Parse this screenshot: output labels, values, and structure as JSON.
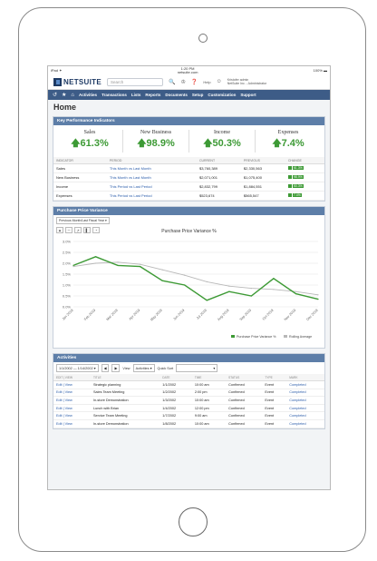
{
  "statusbar": {
    "left": "iPad ✦",
    "time": "1:20 PM",
    "url": "netsuite.com",
    "right": "100% ▬"
  },
  "topbar": {
    "logo_text": "NETSUITE",
    "search_placeholder": "Search",
    "help": "Help",
    "user_name": "Kristofer admin",
    "user_role": "NetSuite Inc. - Administrator"
  },
  "nav": {
    "items": [
      "Activities",
      "Transactions",
      "Lists",
      "Reports",
      "Documents",
      "Setup",
      "Customization",
      "Support"
    ]
  },
  "page_title": "Home",
  "kpi_panel": {
    "title": "Key Performance Indicators",
    "kpis": [
      {
        "label": "Sales",
        "value": "61.3%"
      },
      {
        "label": "New Business",
        "value": "98.9%"
      },
      {
        "label": "Income",
        "value": "50.3%"
      },
      {
        "label": "Expenses",
        "value": "7.4%"
      }
    ],
    "columns": [
      "INDICATOR",
      "PERIOD",
      "CURRENT",
      "PREVIOUS",
      "CHANGE"
    ],
    "rows": [
      {
        "indicator": "Sales",
        "period": "This Month vs Last Month",
        "current": "$3,760,389",
        "previous": "$2,330,563",
        "change": "61.3%"
      },
      {
        "indicator": "New Business",
        "period": "This Month vs Last Month",
        "current": "$2,071,001",
        "previous": "$1,075,400",
        "change": "98.9%"
      },
      {
        "indicator": "Income",
        "period": "This Period vs Last Period",
        "current": "$2,832,799",
        "previous": "$1,884,551",
        "change": "50.3%"
      },
      {
        "indicator": "Expenses",
        "period": "This Period vs Last Period",
        "current": "$523,674",
        "previous": "$565,547",
        "change": "7.4%"
      }
    ]
  },
  "ppv_panel": {
    "title": "Purchase Price Variance",
    "period_select": "Previous Month/Last Fiscal Year",
    "chart_title": "Purchase Price Variance %"
  },
  "chart_data": {
    "type": "line",
    "title": "Purchase Price Variance %",
    "x": [
      "Jan 2019",
      "Feb 2019",
      "Mar 2019",
      "Apr 2019",
      "May 2019",
      "Jun 2019",
      "Jul 2019",
      "Aug 2019",
      "Sep 2019",
      "Oct 2019",
      "Nov 2019",
      "Dec 2019"
    ],
    "y_ticks": [
      "0.0%",
      "0.5%",
      "1.0%",
      "1.5%",
      "2.0%",
      "2.5%",
      "3.0%"
    ],
    "ylim": [
      0,
      3.0
    ],
    "series": [
      {
        "name": "Purchase Price Variance %",
        "color": "#3d9a35",
        "values": [
          1.9,
          2.3,
          1.9,
          1.85,
          1.2,
          1.0,
          0.3,
          0.7,
          0.5,
          1.3,
          0.6,
          0.35
        ]
      },
      {
        "name": "Rolling Average",
        "color": "#b8b8b8",
        "values": [
          1.85,
          2.0,
          2.05,
          1.95,
          1.7,
          1.45,
          1.15,
          0.95,
          0.85,
          0.8,
          0.7,
          0.55
        ]
      }
    ]
  },
  "activities_panel": {
    "title": "Activities",
    "date_range": "1/1/2002 — 1/14/2002",
    "view_label": "View",
    "view_value": "Activities",
    "quick_sort_label": "Quick Sort",
    "columns": [
      "EDIT | VIEW",
      "TITLE",
      "DATE",
      "TIME",
      "STATUS",
      "TYPE",
      "MARK"
    ],
    "rows": [
      {
        "edit": "Edit | View",
        "title": "Strategic planning",
        "date": "1/1/2002",
        "time": "10:00 am",
        "status": "Confirmed",
        "type": "Event",
        "mark": "Completed"
      },
      {
        "edit": "Edit | View",
        "title": "Sales Team Meeting",
        "date": "1/2/2002",
        "time": "2:00 pm",
        "status": "Confirmed",
        "type": "Event",
        "mark": "Completed"
      },
      {
        "edit": "Edit | View",
        "title": "In-store Demonstration",
        "date": "1/3/2002",
        "time": "10:00 am",
        "status": "Confirmed",
        "type": "Event",
        "mark": "Completed"
      },
      {
        "edit": "Edit | View",
        "title": "Lunch with Brian",
        "date": "1/4/2002",
        "time": "12:00 pm",
        "status": "Confirmed",
        "type": "Event",
        "mark": "Completed"
      },
      {
        "edit": "Edit | View",
        "title": "Service Team Meeting",
        "date": "1/7/2002",
        "time": "9:00 am",
        "status": "Confirmed",
        "type": "Event",
        "mark": "Completed"
      },
      {
        "edit": "Edit | View",
        "title": "In-store Demonstration",
        "date": "1/8/2002",
        "time": "10:00 am",
        "status": "Confirmed",
        "type": "Event",
        "mark": "Completed"
      }
    ]
  }
}
